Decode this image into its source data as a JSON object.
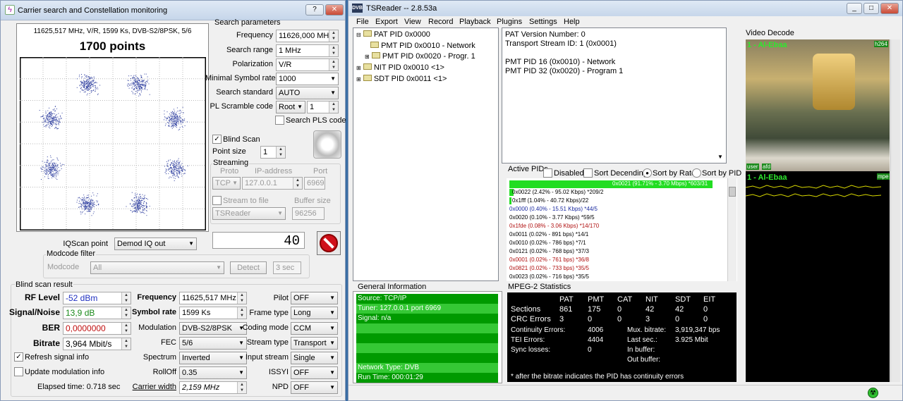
{
  "left_window": {
    "title": "Carrier search and Constellation monitoring",
    "help_btn": "?",
    "close_btn": "✕",
    "constellation": {
      "header": "11625,517 MHz, V/R, 1599 Ks, DVB-S2/8PSK, 5/6",
      "points": "1700 points"
    },
    "search_params": {
      "title": "Search parameters",
      "frequency_label": "Frequency",
      "frequency": "11626,000 MHz",
      "range_label": "Search range",
      "range": "1 MHz",
      "polarization_label": "Polarization",
      "polarization": "V/R",
      "min_sr_label": "Minimal Symbol rate",
      "min_sr": "1000",
      "standard_label": "Search standard",
      "standard": "AUTO",
      "pl_label": "PL Scramble code",
      "pl_mode": "Root",
      "pl_value": "1",
      "search_pls": "Search PLS code"
    },
    "blind_scan": "Blind Scan",
    "point_size_label": "Point size",
    "point_size": "1",
    "streaming": {
      "title": "Streaming",
      "proto_h": "Proto",
      "ip_h": "IP-address",
      "port_h": "Port",
      "proto": "TCP",
      "ip": "127.0.0.1",
      "port": "6969",
      "stream_to_file": "Stream to file",
      "buffer_h": "Buffer size",
      "target": "TSReader",
      "buffer": "96256"
    },
    "iq_label": "IQScan point",
    "iq": "Demod IQ out",
    "counter": "40",
    "modcode": {
      "title": "Modcode filter",
      "label": "Modcode",
      "value": "All",
      "detect": "Detect",
      "interval": "3 sec"
    },
    "result": {
      "title": "Blind scan result",
      "rf_label": "RF Level",
      "rf": "-52 dBm",
      "sn_label": "Signal/Noise",
      "sn": "13,9 dB",
      "ber_label": "BER",
      "ber": "0,0000000",
      "bitrate_label": "Bitrate",
      "bitrate": "3,964 Mbit/s",
      "freq_label": "Frequency",
      "freq": "11625,517 MHz",
      "sr_label": "Symbol rate",
      "sr": "1599 Ks",
      "mod_label": "Modulation",
      "mod": "DVB-S2/8PSK",
      "fec_label": "FEC",
      "fec": "5/6",
      "spectrum_label": "Spectrum",
      "spectrum": "Inverted",
      "rolloff_label": "RollOff",
      "rolloff": "0.35",
      "cw_label": "Carrier width",
      "cw": "2,159 MHz",
      "pilot_label": "Pilot",
      "pilot": "OFF",
      "frame_label": "Frame type",
      "frame": "Long",
      "coding_label": "Coding mode",
      "coding": "CCM",
      "stype_label": "Stream type",
      "stype": "Transport",
      "input_label": "Input stream",
      "input": "Single",
      "issyi_label": "ISSYI",
      "issyi": "OFF",
      "npd_label": "NPD",
      "npd": "OFF"
    },
    "refresh": "Refresh signal info",
    "update_mod": "Update modulation info",
    "elapsed": "Elapsed time: 0.718 sec"
  },
  "tsreader": {
    "title": "TSReader -- 2.8.53a",
    "menu": [
      "File",
      "Export",
      "View",
      "Record",
      "Playback",
      "Plugins",
      "Settings",
      "Help"
    ],
    "tree": [
      "PAT PID 0x0000",
      "PMT PID 0x0010 - Network",
      "PMT PID 0x0020 - Progr. 1",
      "NIT PID 0x0010 <1>",
      "SDT PID 0x0011 <1>"
    ],
    "info": [
      "PAT Version Number: 0",
      "Transport Stream ID: 1 (0x0001)",
      "",
      "PMT PID 16 (0x0010) - Network",
      "PMT PID 32 (0x0020) - Program 1"
    ],
    "video_title": "Video Decode",
    "channel_top": "1 - Al-Ebaa",
    "codec": "h264",
    "user": "user",
    "afd": "afd",
    "channel_bottom": "1 - Al-Ebaa",
    "mpeg_tag": "mpe",
    "active_title": "Active PIDs",
    "disabled": "Disabled",
    "sort_desc": "Sort Decending",
    "sort_rate": "Sort by Rate",
    "sort_pid": "Sort by PID",
    "pids": [
      {
        "t": "0x0021 (91.71% - 3.70 Mbps) *603/31",
        "c": "#000"
      },
      {
        "t": "0x0022 (2.42% - 95.02 Kbps) *209/2",
        "c": "#000"
      },
      {
        "t": "0x1fff (1.04% - 40.72 Kbps)/22",
        "c": "#000"
      },
      {
        "t": "0x0000 (0.40% - 15.51 Kbps) *44/5",
        "c": "#1a2aa0"
      },
      {
        "t": "0x0020 (0.10% - 3.77 Kbps) *59/5",
        "c": "#000"
      },
      {
        "t": "0x1fde (0.08% - 3.06 Kbps) *14/170",
        "c": "#b01010"
      },
      {
        "t": "0x0011 (0.02% - 891 bps) *14/1",
        "c": "#000"
      },
      {
        "t": "0x0010 (0.02% - 786 bps) *7/1",
        "c": "#000"
      },
      {
        "t": "0x0121 (0.02% - 768 bps) *37/3",
        "c": "#000"
      },
      {
        "t": "0x0001 (0.02% - 761 bps) *36/8",
        "c": "#b01010"
      },
      {
        "t": "0x0821 (0.02% - 733 bps) *35/5",
        "c": "#b01010"
      },
      {
        "t": "0x0023 (0.02% - 716 bps) *35/5",
        "c": "#000"
      }
    ],
    "general_title": "General Information",
    "general": [
      "Source: TCP/IP",
      "Tuner: 127.0.0.1 port 6969",
      "Signal: n/a",
      "",
      "",
      "",
      "",
      "Network Type: DVB",
      "Run Time: 000:01:29"
    ],
    "mpeg_title": "MPEG-2 Statistics",
    "stats": {
      "cols": [
        "PAT",
        "PMT",
        "CAT",
        "NIT",
        "SDT",
        "EIT"
      ],
      "sections_label": "Sections",
      "sections": [
        "861",
        "175",
        "0",
        "42",
        "42",
        "0"
      ],
      "crc_label": "CRC Errors",
      "crc": [
        "3",
        "0",
        "0",
        "3",
        "0",
        "0"
      ],
      "cont_label": "Continuity Errors:",
      "cont": "4006",
      "tei_label": "TEI Errors:",
      "tei": "4404",
      "sync_label": "Sync losses:",
      "sync": "0",
      "mux_label": "Mux. bitrate:",
      "mux": "3,919,347 bps",
      "last_label": "Last sec.:",
      "last": "3.925 Mbit",
      "inbuf_label": "In buffer:",
      "outbuf_label": "Out buffer:",
      "note": "* after the bitrate indicates the PID has continuity errors"
    }
  }
}
